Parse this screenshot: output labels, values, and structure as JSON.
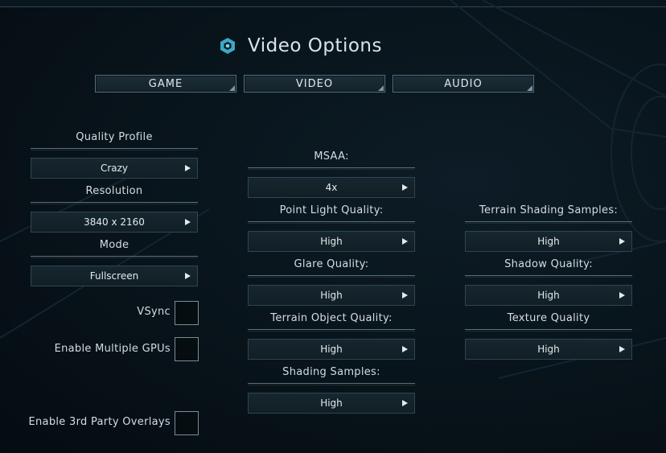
{
  "title": "Video Options",
  "icons": {
    "logo": "hexagon-logo-icon",
    "dropdown": "caret-right-icon"
  },
  "colors": {
    "background": "#08131a",
    "accent": "#3aa8c8",
    "text": "#d6e2e8",
    "border": "#52707c"
  },
  "tabs": [
    {
      "label": "GAME"
    },
    {
      "label": "VIDEO"
    },
    {
      "label": "AUDIO"
    }
  ],
  "left": {
    "quality_profile": {
      "label": "Quality Profile",
      "value": "Crazy"
    },
    "resolution": {
      "label": "Resolution",
      "value": "3840 x 2160"
    },
    "mode": {
      "label": "Mode",
      "value": "Fullscreen"
    },
    "vsync": {
      "label": "VSync",
      "checked": false
    },
    "multi_gpu": {
      "label": "Enable Multiple GPUs",
      "checked": false
    },
    "overlays": {
      "label": "Enable 3rd Party Overlays",
      "checked": false
    }
  },
  "middle": {
    "msaa": {
      "label": "MSAA:",
      "value": "4x"
    },
    "point_light": {
      "label": "Point Light Quality:",
      "value": "High"
    },
    "glare": {
      "label": "Glare Quality:",
      "value": "High"
    },
    "terrain_object": {
      "label": "Terrain Object Quality:",
      "value": "High"
    },
    "shading_samples": {
      "label": "Shading Samples:",
      "value": "High"
    }
  },
  "right": {
    "terrain_shading": {
      "label": "Terrain Shading Samples:",
      "value": "High"
    },
    "shadow": {
      "label": "Shadow Quality:",
      "value": "High"
    },
    "texture": {
      "label": "Texture Quality",
      "value": "High"
    }
  }
}
